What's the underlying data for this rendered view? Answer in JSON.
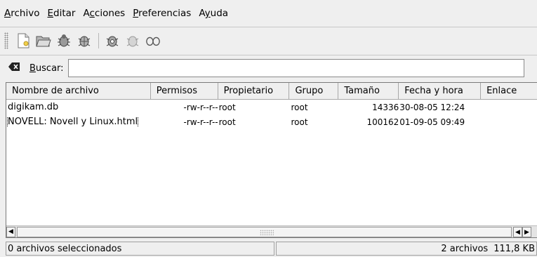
{
  "menubar": {
    "items": [
      {
        "pre": "",
        "u": "A",
        "post": "rchivo"
      },
      {
        "pre": "",
        "u": "E",
        "post": "ditar"
      },
      {
        "pre": "A",
        "u": "c",
        "post": "ciones"
      },
      {
        "pre": "",
        "u": "P",
        "post": "referencias"
      },
      {
        "pre": "A",
        "u": "y",
        "post": "uda"
      }
    ]
  },
  "toolbar": {
    "buttons": [
      "new-file-icon",
      "open-folder-icon",
      "bug-icon",
      "bug-alt-icon",
      "bug-settings-icon",
      "bug-disabled-icon",
      "glasses-icon"
    ]
  },
  "search": {
    "label_u": "B",
    "label_rest": "uscar:",
    "value": ""
  },
  "table": {
    "columns": [
      "Nombre de archivo",
      "Permisos",
      "Propietario",
      "Grupo",
      "Tamaño",
      "Fecha y hora",
      "Enlace"
    ],
    "rows": [
      {
        "name": "digikam.db",
        "perm": "-rw-r--r--",
        "owner": "root",
        "group": "root",
        "size": "14336",
        "date": "30-08-05 12:24",
        "link": ""
      },
      {
        "name": "NOVELL: Novell y Linux.html",
        "perm": "-rw-r--r--",
        "owner": "root",
        "group": "root",
        "size": "100162",
        "date": "01-09-05 09:49",
        "link": ""
      }
    ]
  },
  "status": {
    "selected": "0 archivos seleccionados",
    "count": "2 archivos",
    "size": "111,8 KB"
  }
}
